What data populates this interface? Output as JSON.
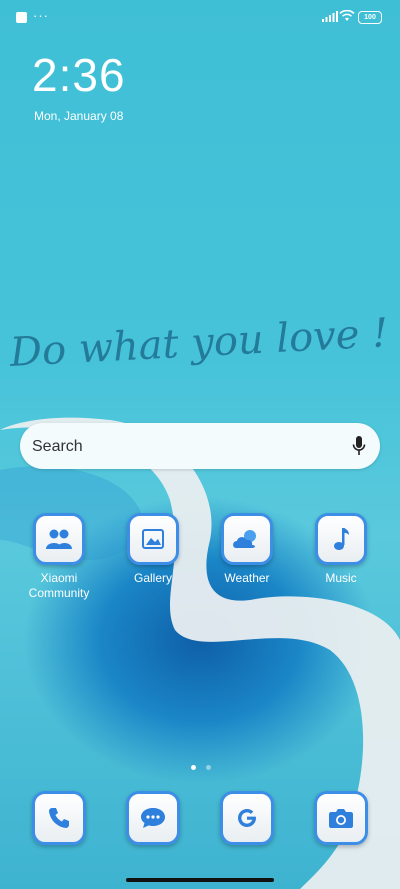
{
  "status_bar": {
    "dots": "···",
    "battery": "100"
  },
  "lockclock": {
    "time": "2:36",
    "date": "Mon, January 08"
  },
  "wallpaper_quote": "Do what you love !",
  "search": {
    "placeholder": "Search"
  },
  "apps": [
    {
      "label": "Xiaomi Community",
      "icon": "community-icon"
    },
    {
      "label": "Gallery",
      "icon": "gallery-icon"
    },
    {
      "label": "Weather",
      "icon": "weather-icon"
    },
    {
      "label": "Music",
      "icon": "music-icon"
    }
  ],
  "dock": [
    {
      "icon": "phone-icon"
    },
    {
      "icon": "messages-icon"
    },
    {
      "icon": "google-icon"
    },
    {
      "icon": "camera-icon"
    }
  ],
  "pager": {
    "pages": 2,
    "current": 1
  },
  "colors": {
    "accent": "#3d8ee6",
    "icon_fill": "#2f7fdc",
    "background": "#46c3d9"
  }
}
